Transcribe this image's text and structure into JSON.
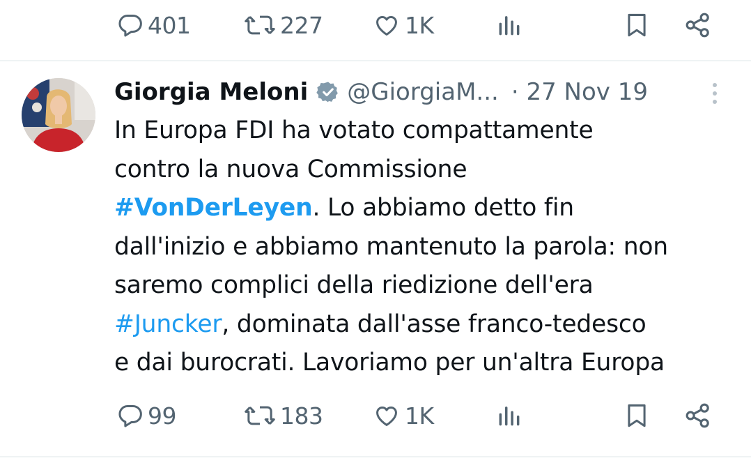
{
  "colors": {
    "text": "#0f1419",
    "muted": "#536471",
    "link": "#1d9bf0",
    "divider": "#eff3f4"
  },
  "prev_tweet_actions": {
    "reply_count": "401",
    "retweet_count": "227",
    "like_count": "1K"
  },
  "tweet": {
    "author_name": "Giorgia Meloni",
    "handle": "@GiorgiaM...",
    "date": "· 27 Nov 19",
    "text": {
      "line1": "In Europa FDI ha votato compattamente",
      "line2": "contro la nuova Commissione",
      "hashtag1": "#VonDerLeyen",
      "line3_rest": ". Lo abbiamo detto fin",
      "line4": "dall'inizio e abbiamo mantenuto la parola: non",
      "line5": "saremo complici della riedizione dell'era",
      "hashtag2": "#Juncker",
      "line6_rest": ", dominata dall'asse franco-tedesco",
      "line7": "e dai burocrati. Lavoriamo per un'altra Europa"
    },
    "actions": {
      "reply_count": "99",
      "retweet_count": "183",
      "like_count": "1K"
    }
  },
  "icons": {
    "reply": "reply-icon",
    "retweet": "retweet-icon",
    "like": "heart-icon",
    "views": "analytics-icon",
    "bookmark": "bookmark-icon",
    "share": "share-icon",
    "verified": "verified-badge-icon",
    "more": "more-icon"
  }
}
